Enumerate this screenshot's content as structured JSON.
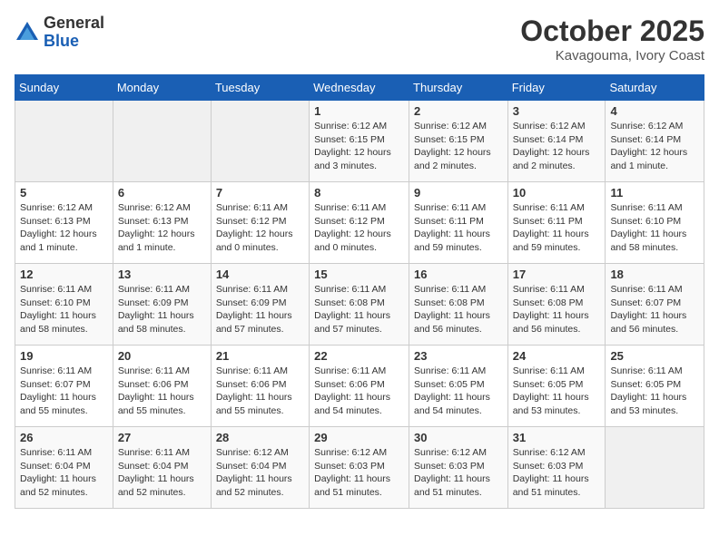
{
  "logo": {
    "general": "General",
    "blue": "Blue"
  },
  "header": {
    "month": "October 2025",
    "location": "Kavagouma, Ivory Coast"
  },
  "weekdays": [
    "Sunday",
    "Monday",
    "Tuesday",
    "Wednesday",
    "Thursday",
    "Friday",
    "Saturday"
  ],
  "weeks": [
    [
      {
        "day": "",
        "info": ""
      },
      {
        "day": "",
        "info": ""
      },
      {
        "day": "",
        "info": ""
      },
      {
        "day": "1",
        "info": "Sunrise: 6:12 AM\nSunset: 6:15 PM\nDaylight: 12 hours\nand 3 minutes."
      },
      {
        "day": "2",
        "info": "Sunrise: 6:12 AM\nSunset: 6:15 PM\nDaylight: 12 hours\nand 2 minutes."
      },
      {
        "day": "3",
        "info": "Sunrise: 6:12 AM\nSunset: 6:14 PM\nDaylight: 12 hours\nand 2 minutes."
      },
      {
        "day": "4",
        "info": "Sunrise: 6:12 AM\nSunset: 6:14 PM\nDaylight: 12 hours\nand 1 minute."
      }
    ],
    [
      {
        "day": "5",
        "info": "Sunrise: 6:12 AM\nSunset: 6:13 PM\nDaylight: 12 hours\nand 1 minute."
      },
      {
        "day": "6",
        "info": "Sunrise: 6:12 AM\nSunset: 6:13 PM\nDaylight: 12 hours\nand 1 minute."
      },
      {
        "day": "7",
        "info": "Sunrise: 6:11 AM\nSunset: 6:12 PM\nDaylight: 12 hours\nand 0 minutes."
      },
      {
        "day": "8",
        "info": "Sunrise: 6:11 AM\nSunset: 6:12 PM\nDaylight: 12 hours\nand 0 minutes."
      },
      {
        "day": "9",
        "info": "Sunrise: 6:11 AM\nSunset: 6:11 PM\nDaylight: 11 hours\nand 59 minutes."
      },
      {
        "day": "10",
        "info": "Sunrise: 6:11 AM\nSunset: 6:11 PM\nDaylight: 11 hours\nand 59 minutes."
      },
      {
        "day": "11",
        "info": "Sunrise: 6:11 AM\nSunset: 6:10 PM\nDaylight: 11 hours\nand 58 minutes."
      }
    ],
    [
      {
        "day": "12",
        "info": "Sunrise: 6:11 AM\nSunset: 6:10 PM\nDaylight: 11 hours\nand 58 minutes."
      },
      {
        "day": "13",
        "info": "Sunrise: 6:11 AM\nSunset: 6:09 PM\nDaylight: 11 hours\nand 58 minutes."
      },
      {
        "day": "14",
        "info": "Sunrise: 6:11 AM\nSunset: 6:09 PM\nDaylight: 11 hours\nand 57 minutes."
      },
      {
        "day": "15",
        "info": "Sunrise: 6:11 AM\nSunset: 6:08 PM\nDaylight: 11 hours\nand 57 minutes."
      },
      {
        "day": "16",
        "info": "Sunrise: 6:11 AM\nSunset: 6:08 PM\nDaylight: 11 hours\nand 56 minutes."
      },
      {
        "day": "17",
        "info": "Sunrise: 6:11 AM\nSunset: 6:08 PM\nDaylight: 11 hours\nand 56 minutes."
      },
      {
        "day": "18",
        "info": "Sunrise: 6:11 AM\nSunset: 6:07 PM\nDaylight: 11 hours\nand 56 minutes."
      }
    ],
    [
      {
        "day": "19",
        "info": "Sunrise: 6:11 AM\nSunset: 6:07 PM\nDaylight: 11 hours\nand 55 minutes."
      },
      {
        "day": "20",
        "info": "Sunrise: 6:11 AM\nSunset: 6:06 PM\nDaylight: 11 hours\nand 55 minutes."
      },
      {
        "day": "21",
        "info": "Sunrise: 6:11 AM\nSunset: 6:06 PM\nDaylight: 11 hours\nand 55 minutes."
      },
      {
        "day": "22",
        "info": "Sunrise: 6:11 AM\nSunset: 6:06 PM\nDaylight: 11 hours\nand 54 minutes."
      },
      {
        "day": "23",
        "info": "Sunrise: 6:11 AM\nSunset: 6:05 PM\nDaylight: 11 hours\nand 54 minutes."
      },
      {
        "day": "24",
        "info": "Sunrise: 6:11 AM\nSunset: 6:05 PM\nDaylight: 11 hours\nand 53 minutes."
      },
      {
        "day": "25",
        "info": "Sunrise: 6:11 AM\nSunset: 6:05 PM\nDaylight: 11 hours\nand 53 minutes."
      }
    ],
    [
      {
        "day": "26",
        "info": "Sunrise: 6:11 AM\nSunset: 6:04 PM\nDaylight: 11 hours\nand 52 minutes."
      },
      {
        "day": "27",
        "info": "Sunrise: 6:11 AM\nSunset: 6:04 PM\nDaylight: 11 hours\nand 52 minutes."
      },
      {
        "day": "28",
        "info": "Sunrise: 6:12 AM\nSunset: 6:04 PM\nDaylight: 11 hours\nand 52 minutes."
      },
      {
        "day": "29",
        "info": "Sunrise: 6:12 AM\nSunset: 6:03 PM\nDaylight: 11 hours\nand 51 minutes."
      },
      {
        "day": "30",
        "info": "Sunrise: 6:12 AM\nSunset: 6:03 PM\nDaylight: 11 hours\nand 51 minutes."
      },
      {
        "day": "31",
        "info": "Sunrise: 6:12 AM\nSunset: 6:03 PM\nDaylight: 11 hours\nand 51 minutes."
      },
      {
        "day": "",
        "info": ""
      }
    ]
  ]
}
